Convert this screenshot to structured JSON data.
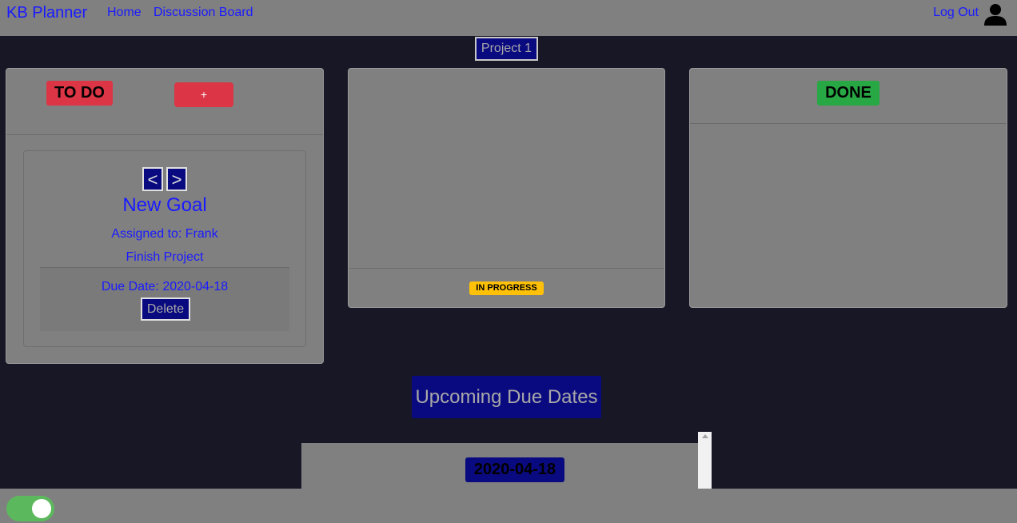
{
  "nav": {
    "brand": "KB Planner",
    "links": [
      "Home",
      "Discussion Board"
    ],
    "logout": "Log Out",
    "user_icon": "user-icon"
  },
  "project": {
    "label": "Project 1"
  },
  "columns": {
    "todo": {
      "badge": "TO DO",
      "add_label": "+",
      "cards": [
        {
          "prev_label": "<",
          "next_label": ">",
          "title": "New Goal",
          "assigned": "Assigned to: Frank",
          "description": "Finish Project",
          "due": "Due Date: 2020-04-18",
          "delete_label": "Delete"
        }
      ]
    },
    "in_progress": {
      "badge": "IN PROGRESS"
    },
    "done": {
      "badge": "DONE"
    }
  },
  "upcoming": {
    "title": "Upcoming Due Dates",
    "dates": [
      "2020-04-18"
    ]
  },
  "theme_toggle": {
    "on": true
  },
  "colors": {
    "background": "#181726",
    "panel": "#808080",
    "link": "#1a1aff",
    "navy": "#0a0a80",
    "danger": "#dc3545",
    "warning": "#ffc107",
    "success": "#28a745",
    "toggle": "#5cb85c"
  }
}
